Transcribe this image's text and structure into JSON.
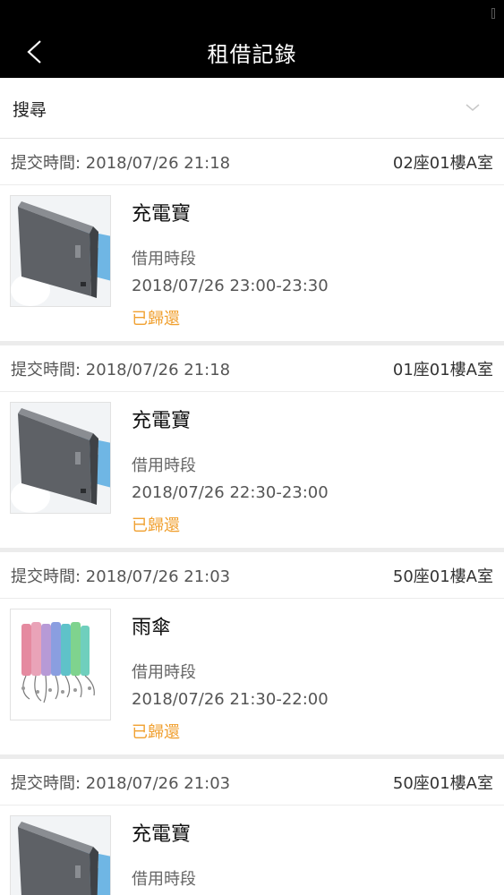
{
  "header": {
    "title": "租借記錄",
    "back_icon": "chevron-left-icon"
  },
  "search": {
    "label": "搜尋",
    "chevron_icon": "chevron-down-icon"
  },
  "records": [
    {
      "submit_time": "提交時間: 2018/07/26 21:18",
      "room": "02座01樓A室",
      "item_name": "充電寶",
      "period_label": "借用時段",
      "period_value": "2018/07/26 23:00-23:30",
      "status": "已歸還",
      "image": "power-bank"
    },
    {
      "submit_time": "提交時間: 2018/07/26 21:18",
      "room": "01座01樓A室",
      "item_name": "充電寶",
      "period_label": "借用時段",
      "period_value": "2018/07/26 22:30-23:00",
      "status": "已歸還",
      "image": "power-bank"
    },
    {
      "submit_time": "提交時間: 2018/07/26 21:03",
      "room": "50座01樓A室",
      "item_name": "雨傘",
      "period_label": "借用時段",
      "period_value": "2018/07/26 21:30-22:00",
      "status": "已歸還",
      "image": "umbrella"
    },
    {
      "submit_time": "提交時間: 2018/07/26 21:03",
      "room": "50座01樓A室",
      "item_name": "充電寶",
      "period_label": "借用時段",
      "image": "power-bank"
    }
  ],
  "colors": {
    "nav_background": "#000000",
    "status_returned": "#f0a030",
    "separator": "#ececec"
  }
}
